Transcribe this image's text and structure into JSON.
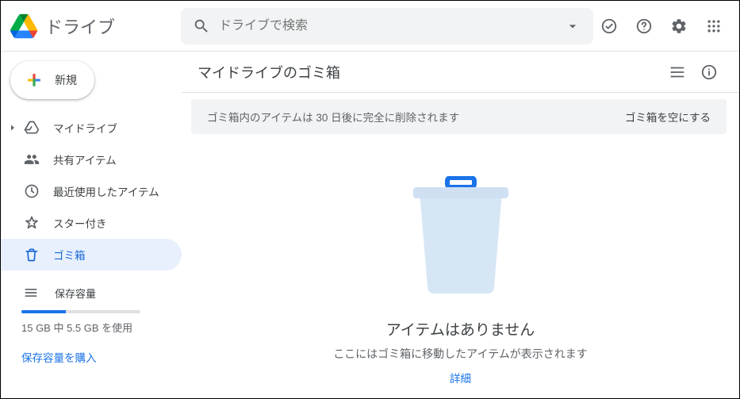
{
  "app": {
    "name": "ドライブ"
  },
  "search": {
    "placeholder": "ドライブで検索"
  },
  "sidebar": {
    "new_label": "新規",
    "items": [
      {
        "label": "マイドライブ"
      },
      {
        "label": "共有アイテム"
      },
      {
        "label": "最近使用したアイテム"
      },
      {
        "label": "スター付き"
      },
      {
        "label": "ゴミ箱"
      }
    ],
    "storage_label": "保存容量",
    "usage_text": "15 GB 中 5.5 GB を使用",
    "buy_label": "保存容量を購入"
  },
  "main": {
    "title": "マイドライブのゴミ箱",
    "banner_text": "ゴミ箱内のアイテムは 30 日後に完全に削除されます",
    "empty_trash_label": "ゴミ箱を空にする",
    "empty_title": "アイテムはありません",
    "empty_sub": "ここにはゴミ箱に移動したアイテムが表示されます",
    "details_link": "詳細"
  }
}
